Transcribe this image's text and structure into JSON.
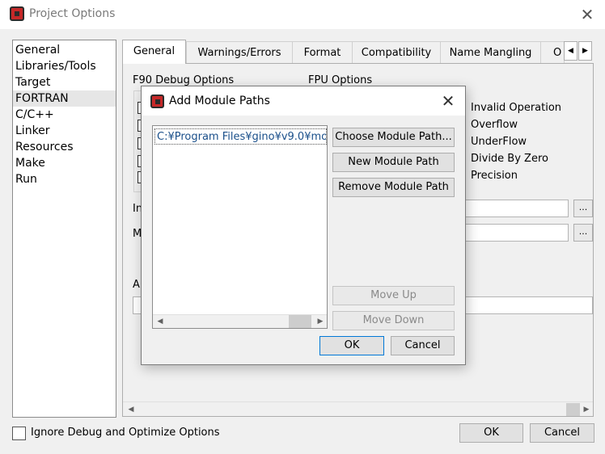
{
  "window": {
    "title": "Project Options",
    "close_glyph": "✕"
  },
  "sidebar": {
    "items": [
      {
        "label": "General"
      },
      {
        "label": "Libraries/Tools"
      },
      {
        "label": "Target"
      },
      {
        "label": "FORTRAN",
        "selected": true
      },
      {
        "label": "C/C++"
      },
      {
        "label": "Linker"
      },
      {
        "label": "Resources"
      },
      {
        "label": "Make"
      },
      {
        "label": "Run"
      }
    ]
  },
  "tabs": {
    "items": [
      {
        "label": "General",
        "active": true
      },
      {
        "label": "Warnings/Errors"
      },
      {
        "label": "Format"
      },
      {
        "label": "Compatibility"
      },
      {
        "label": "Name Mangling"
      },
      {
        "label": "O"
      }
    ],
    "scroll_left": "◀",
    "scroll_right": "▶"
  },
  "panel": {
    "f90_debug_label": "F90 Debug Options",
    "fpu_label": "FPU Options",
    "fpu_options": [
      "Invalid Operation",
      "Overflow",
      "UnderFlow",
      "Divide By Zero",
      "Precision"
    ],
    "field1_label_fragment": "In",
    "field2_label_fragment": "M",
    "field3_label_fragment": "A",
    "ellipsis": "...",
    "hscroll_left": "◀",
    "hscroll_right": "▶"
  },
  "dialog": {
    "title": "Add Module Paths",
    "close_glyph": "✕",
    "paths": [
      "C:¥Program Files¥gino¥v9.0¥mo"
    ],
    "buttons": {
      "choose": "Choose Module Path...",
      "new": "New Module Path",
      "remove": "Remove Module Path",
      "move_up": "Move Up",
      "move_down": "Move Down",
      "ok": "OK",
      "cancel": "Cancel"
    },
    "scroll_left": "◀",
    "scroll_right": "▶"
  },
  "footer": {
    "ignore_debug_label": "Ignore Debug and Optimize Options",
    "ok": "OK",
    "cancel": "Cancel"
  }
}
